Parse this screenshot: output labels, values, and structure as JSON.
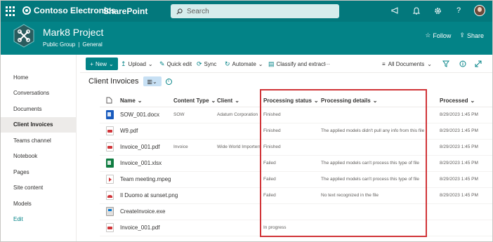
{
  "suite_bar": {
    "brand": "Contoso Electronics",
    "app_name": "SharePoint",
    "search_placeholder": "Search",
    "colors": {
      "background": "#03787c"
    },
    "icons": [
      "waffle-icon",
      "megaphone-icon",
      "notification-bell-icon",
      "settings-gear-icon",
      "help-icon",
      "user-avatar"
    ]
  },
  "site_header": {
    "title": "Mark8 Project",
    "group_type": "Public Group",
    "separator": "|",
    "classification": "General",
    "follow_label": "Follow",
    "share_label": "Share",
    "colors": {
      "background": "#038387"
    }
  },
  "left_nav": {
    "items": [
      {
        "label": "Home",
        "selected": false
      },
      {
        "label": "Conversations",
        "selected": false
      },
      {
        "label": "Documents",
        "selected": false
      },
      {
        "label": "Client Invoices",
        "selected": true
      },
      {
        "label": "Teams channel",
        "selected": false
      },
      {
        "label": "Notebook",
        "selected": false
      },
      {
        "label": "Pages",
        "selected": false
      },
      {
        "label": "Site content",
        "selected": false
      },
      {
        "label": "Models",
        "selected": false
      }
    ],
    "edit_label": "Edit"
  },
  "command_bar": {
    "new_label": "New",
    "upload_label": "Upload",
    "quick_edit_label": "Quick edit",
    "sync_label": "Sync",
    "automate_label": "Automate",
    "classify_label": "Classify and extract",
    "more_label": "···",
    "view_label": "All Documents"
  },
  "library": {
    "title": "Client Invoices",
    "columns": {
      "name": "Name",
      "content_type": "Content Type",
      "client": "Client",
      "processing_status": "Processing status",
      "processing_details": "Processing details",
      "processed": "Processed"
    },
    "rows": [
      {
        "icon": "word",
        "name": "SOW_001.docx",
        "content_type": "SOW",
        "client": "Adatum Corporation",
        "status": "Finished",
        "details": "",
        "processed": "8/29/2023 1:45 PM"
      },
      {
        "icon": "pdf",
        "name": "W9.pdf",
        "content_type": "",
        "client": "",
        "status": "Finished",
        "details": "The applied models didn't pull any info from this file",
        "processed": "8/29/2023 1:45 PM"
      },
      {
        "icon": "pdf",
        "name": "Invoice_001.pdf",
        "content_type": "Invoice",
        "client": "Wide World Importers",
        "status": "Finished",
        "details": "",
        "processed": "8/29/2023 1:45 PM"
      },
      {
        "icon": "excel",
        "name": "Invoice_001.xlsx",
        "content_type": "",
        "client": "",
        "status": "Failed",
        "details": "The applied models can't process this type of file",
        "processed": "8/29/2023 1:45 PM"
      },
      {
        "icon": "video",
        "name": "Team meeting.mpeg",
        "content_type": "",
        "client": "",
        "status": "Failed",
        "details": "The applied models can't process this type of file",
        "processed": "8/29/2023 1:45 PM"
      },
      {
        "icon": "image",
        "name": "Il Duomo at sunset.png",
        "content_type": "",
        "client": "",
        "status": "Failed",
        "details": "No text recognized in the file",
        "processed": "8/29/2023 1:45 PM"
      },
      {
        "icon": "exe",
        "name": "CreateInvoice.exe",
        "content_type": "",
        "client": "",
        "status": "",
        "details": "",
        "processed": ""
      },
      {
        "icon": "pdf",
        "name": "Invoice_001.pdf",
        "content_type": "",
        "client": "",
        "status": "In progress",
        "details": "",
        "processed": ""
      }
    ]
  },
  "annotation": {
    "highlight_color": "#d13438"
  }
}
